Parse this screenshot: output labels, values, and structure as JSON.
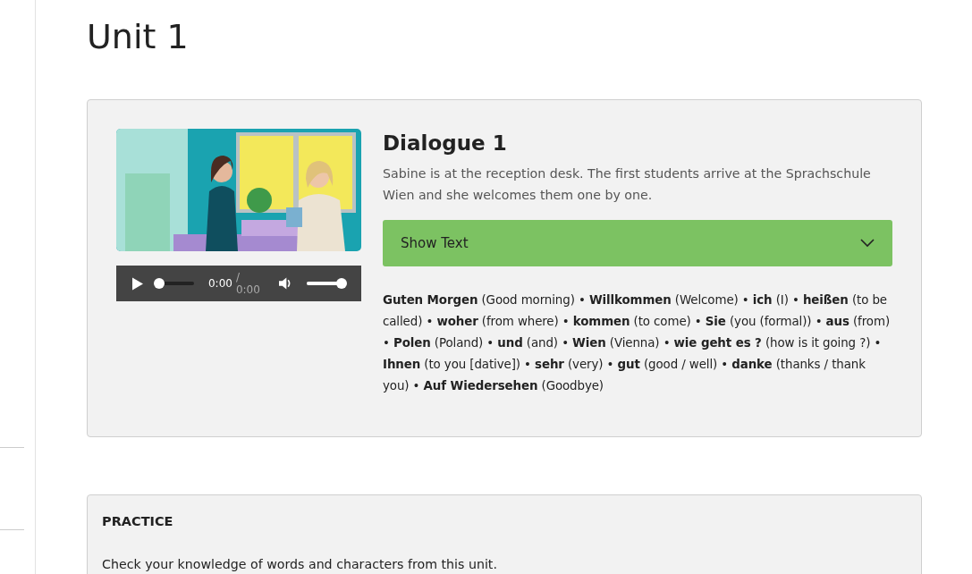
{
  "page": {
    "title": "Unit 1"
  },
  "dialogue": {
    "player": {
      "progress": {
        "level": 0
      },
      "time_current": "0:00",
      "time_total": "/ 0:00",
      "volume": {
        "level": 1
      }
    },
    "title": "Dialogue 1",
    "description": "Sabine is at the reception desk. The first students arrive at the Sprachschule Wien and she welcomes them one by one.",
    "toggle": {
      "label": "Show Text",
      "expanded": false
    },
    "vocabulary": "**Guten Morgen** (Good morning) • **Willkommen** (Welcome) • **ich** (I) • **heißen** (to be called) • **woher** (from where) • **kommen** (to come) • **Sie** (you (formal)) • **aus** (from) • **Polen** (Poland) • **und** (and) • **Wien** (Vienna) • **wie geht es ?** (how is it going ?) • **Ihnen** (to you [dative]) • **sehr** (very) • **gut** (good / well) • **danke** (thanks / thank you) • **Auf Wiedersehen** (Goodbye)"
  },
  "practice": {
    "heading": "PRACTICE",
    "text": "Check your knowledge of words and characters from this unit."
  }
}
